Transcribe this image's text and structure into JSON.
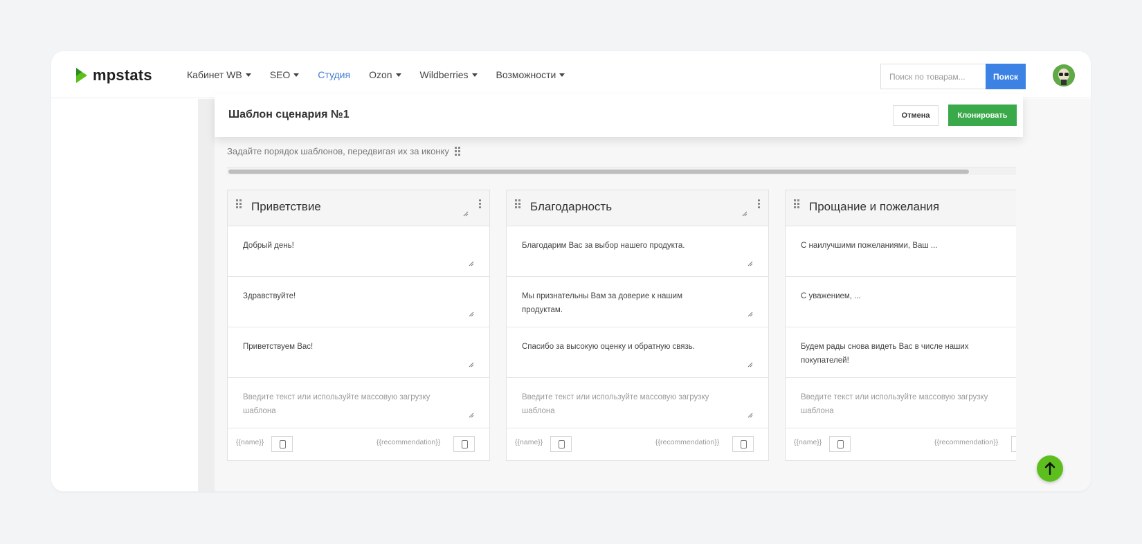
{
  "brand": {
    "name": "mpstats",
    "accent": "#5dbf1d"
  },
  "nav": {
    "items": [
      {
        "label": "Кабинет WB",
        "dropdown": true,
        "active": false
      },
      {
        "label": "SEO",
        "dropdown": true,
        "active": false
      },
      {
        "label": "Студия",
        "dropdown": false,
        "active": true
      },
      {
        "label": "Ozon",
        "dropdown": true,
        "active": false
      },
      {
        "label": "Wildberries",
        "dropdown": true,
        "active": false
      },
      {
        "label": "Возможности",
        "dropdown": true,
        "active": false
      }
    ]
  },
  "search": {
    "placeholder": "Поиск по товарам...",
    "button_label": "Поиск"
  },
  "page": {
    "title": "Шаблон сценария №1",
    "cancel_label": "Отмена",
    "clone_label": "Клонировать",
    "hint": "Задайте порядок шаблонов, передвигая их за иконку"
  },
  "columns": [
    {
      "title": "Приветствие",
      "templates": [
        "Добрый день!",
        "Здравствуйте!",
        "Приветствуем Вас!"
      ],
      "placeholder": "Введите текст или используйте массовую загрузку шаблона",
      "var_name": "{{name}}",
      "var_recommendation": "{{recommendation}}"
    },
    {
      "title": "Благодарность",
      "templates": [
        "Благодарим Вас за выбор нашего продукта.",
        "Мы признательны Вам за доверие к нашим продуктам.",
        "Спасибо за высокую оценку и обратную связь."
      ],
      "placeholder": "Введите текст или используйте массовую загрузку шаблона",
      "var_name": "{{name}}",
      "var_recommendation": "{{recommendation}}"
    },
    {
      "title": "Прощание и пожелания",
      "templates": [
        "С наилучшими пожеланиями, Ваш ...",
        "С уважением, ...",
        "Будем рады снова видеть Вас в числе наших покупателей!"
      ],
      "placeholder": "Введите текст или используйте массовую загрузку шаблона",
      "var_name": "{{name}}",
      "var_recommendation": "{{recommendation}}"
    }
  ],
  "icons": {
    "drag": "grip-icon",
    "menu": "kebab-icon",
    "resize": "resize-icon",
    "copy": "copy-icon",
    "scroll_top": "arrow-up-icon"
  }
}
